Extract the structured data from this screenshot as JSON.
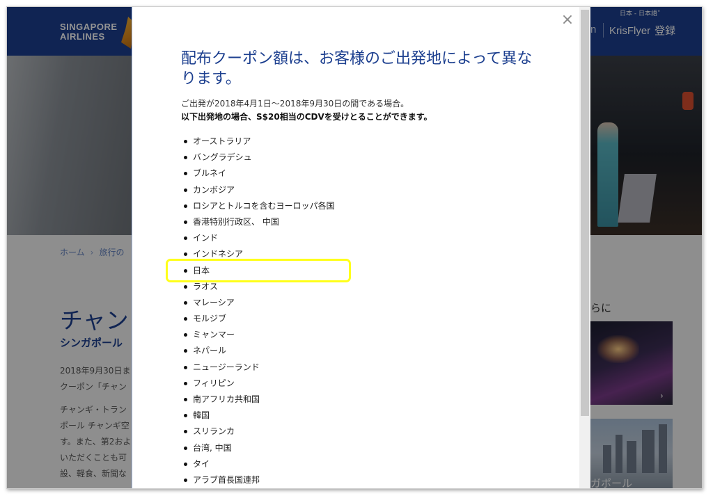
{
  "header": {
    "logo_line1": "SINGAPORE",
    "logo_line2": "AIRLINES",
    "language": "日本 - 日本語",
    "login_partial": "n",
    "krisflyer": "KrisFlyer",
    "register": "登録"
  },
  "breadcrumb": {
    "home": "ホーム",
    "separator": "›",
    "current": "旅行の"
  },
  "page": {
    "title": "チャン",
    "subtitle": "シンガポール",
    "para1": [
      "2018年9月30日ま",
      "クーポン「チャン"
    ],
    "para2": [
      "チャンギ・トラン",
      "ポール チャンギ空",
      "す。また、第2およ",
      "いただくことも可",
      "設、軽食、新聞な"
    ]
  },
  "sidebar": {
    "heading": "らに",
    "thumb2_caption": "ガポール"
  },
  "modal": {
    "title": "配布クーポン額は、お客様のご出発地によって異なります。",
    "intro1": "ご出発が2018年4月1日～2018年9月30日の間である場合。",
    "intro2": "以下出発地の場合、S$20相当のCDVを受けとることができます。",
    "countries": [
      "オーストラリア",
      "バングラデシュ",
      "ブルネイ",
      "カンボジア",
      "ロシアとトルコを含むヨーロッパ各国",
      "香港特別行政区、 中国",
      "インド",
      "インドネシア",
      "日本",
      "ラオス",
      "マレーシア",
      "モルジブ",
      "ミャンマー",
      "ネパール",
      "ニュージーランド",
      "フィリピン",
      "南アフリカ共和国",
      "韓国",
      "スリランカ",
      "台湾, 中国",
      "タイ",
      "アラブ首長国連邦"
    ],
    "highlighted_country": "日本",
    "highlight_color": "#ffff1a",
    "close_icon": "close-icon"
  },
  "colors": {
    "brand_blue": "#1c3f8f",
    "logo_gold": "#f2b233"
  }
}
